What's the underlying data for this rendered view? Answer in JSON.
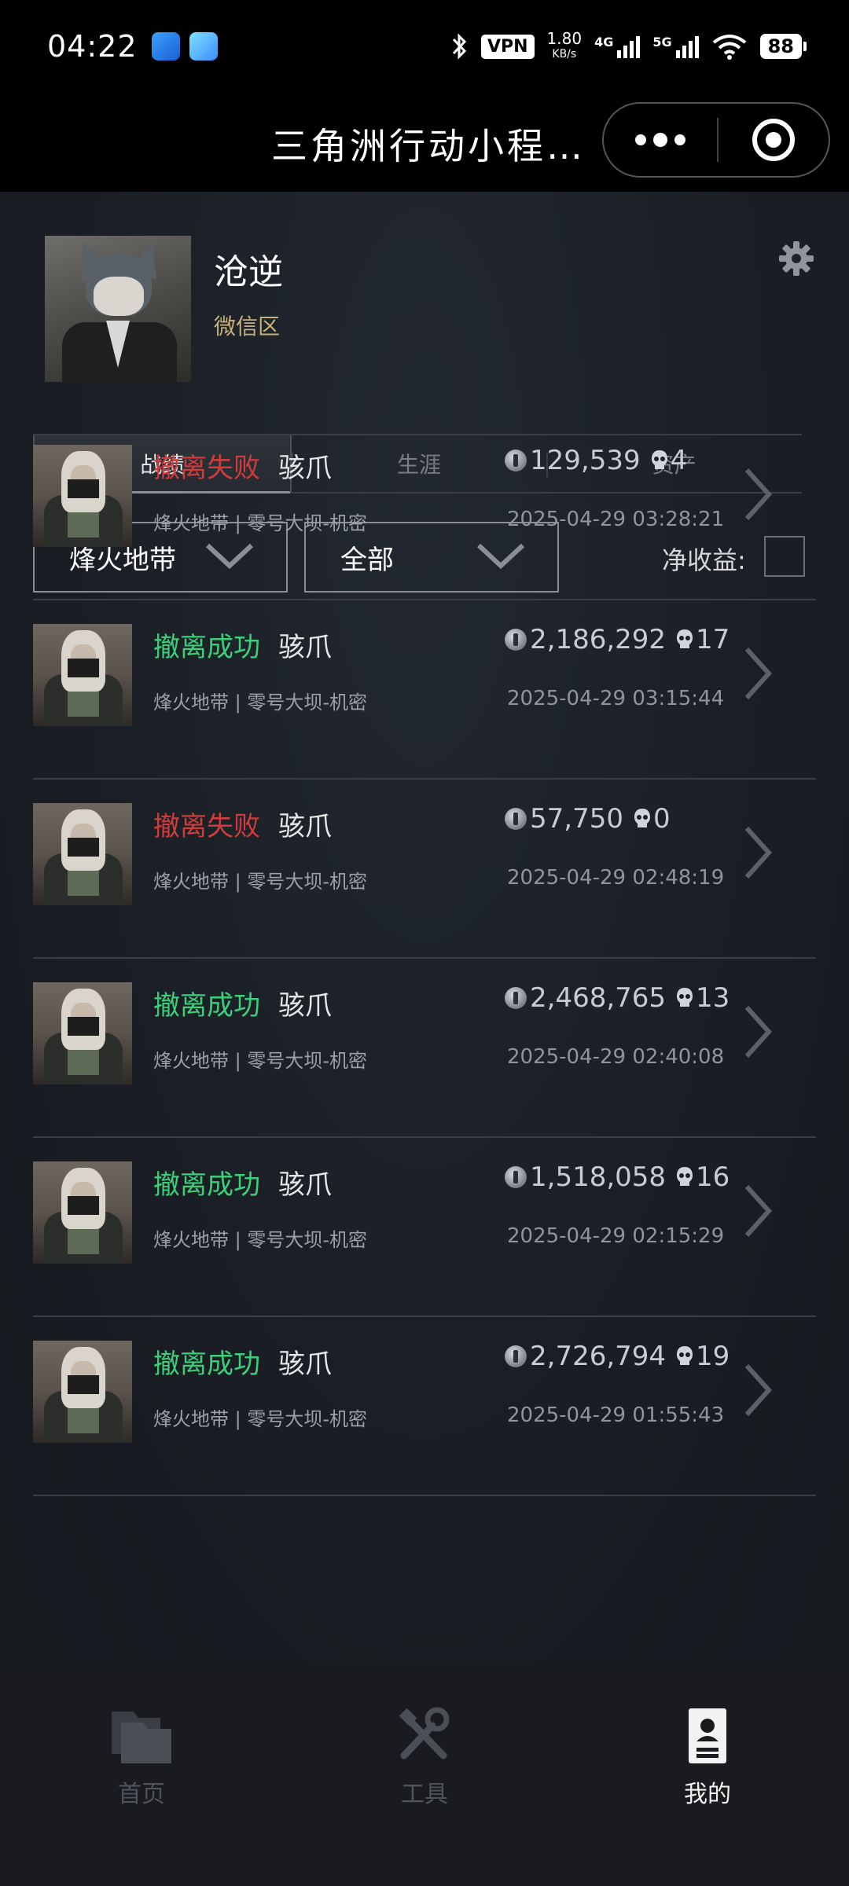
{
  "status_bar": {
    "time": "04:22",
    "vpn": "VPN",
    "net_speed": "1.80",
    "net_unit": "KB/s",
    "sig1_label": "4G",
    "sig2_label": "5G",
    "battery": "88"
  },
  "nav": {
    "title": "三角洲行动小程…"
  },
  "profile": {
    "username": "沧逆",
    "region": "微信区"
  },
  "tabs": [
    {
      "label": "战绩"
    },
    {
      "label": "生涯"
    },
    {
      "label": "资产"
    }
  ],
  "filters": {
    "mode": "烽火地带",
    "scope": "全部",
    "net_label": "净收益:"
  },
  "records": [
    {
      "result": "撤离失败",
      "operator": "骇爪",
      "value": "129,539",
      "kills": "4",
      "map": "烽火地带 | 零号大坝-机密",
      "time": "2025-04-29 03:28:21"
    },
    {
      "result": "撤离成功",
      "operator": "骇爪",
      "value": "2,186,292",
      "kills": "17",
      "map": "烽火地带 | 零号大坝-机密",
      "time": "2025-04-29 03:15:44"
    },
    {
      "result": "撤离失败",
      "operator": "骇爪",
      "value": "57,750",
      "kills": "0",
      "map": "烽火地带 | 零号大坝-机密",
      "time": "2025-04-29 02:48:19"
    },
    {
      "result": "撤离成功",
      "operator": "骇爪",
      "value": "2,468,765",
      "kills": "13",
      "map": "烽火地带 | 零号大坝-机密",
      "time": "2025-04-29 02:40:08"
    },
    {
      "result": "撤离成功",
      "operator": "骇爪",
      "value": "1,518,058",
      "kills": "16",
      "map": "烽火地带 | 零号大坝-机密",
      "time": "2025-04-29 02:15:29"
    },
    {
      "result": "撤离成功",
      "operator": "骇爪",
      "value": "2,726,794",
      "kills": "19",
      "map": "烽火地带 | 零号大坝-机密",
      "time": "2025-04-29 01:55:43"
    }
  ],
  "bottom_nav": [
    {
      "label": "首页",
      "icon": "folder-icon"
    },
    {
      "label": "工具",
      "icon": "tools-icon"
    },
    {
      "label": "我的",
      "icon": "profile-card-icon"
    }
  ],
  "colors": {
    "fail": "#d03c3c",
    "success": "#3ccf7a",
    "region": "#c9b27a"
  }
}
